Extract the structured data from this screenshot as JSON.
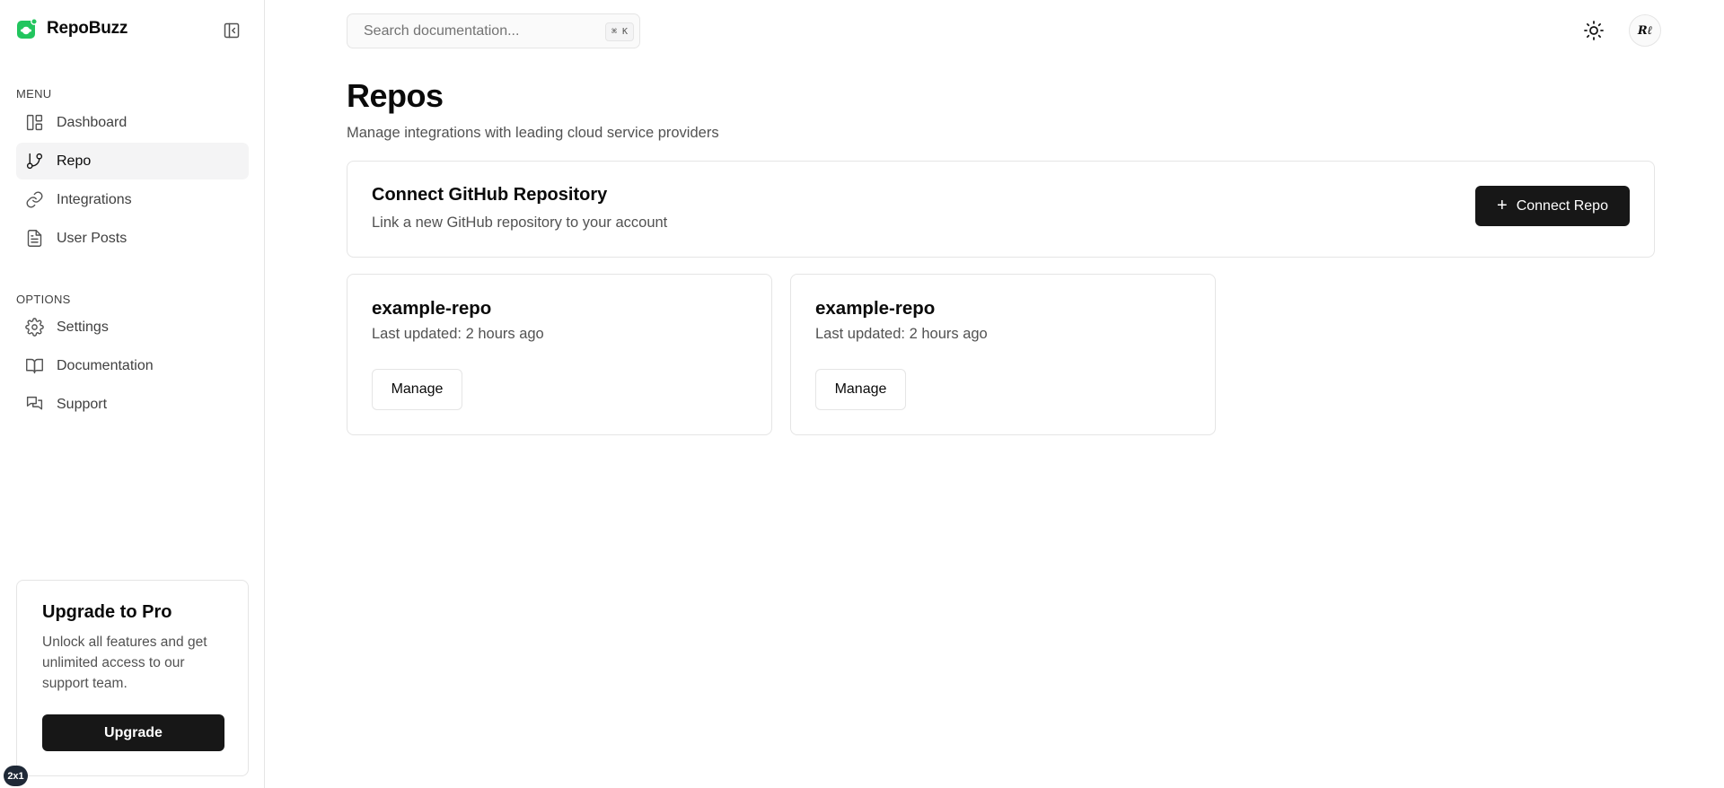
{
  "brand": {
    "name": "RepoBuzz",
    "logo_icon": "repobuzz-logo-icon",
    "accent": "#22c55e"
  },
  "sidebar": {
    "menu_label": "MENU",
    "menu_items": [
      {
        "label": "Dashboard",
        "icon": "dashboard-icon",
        "active": false
      },
      {
        "label": "Repo",
        "icon": "git-branch-icon",
        "active": true
      },
      {
        "label": "Integrations",
        "icon": "link-icon",
        "active": false
      },
      {
        "label": "User Posts",
        "icon": "file-text-icon",
        "active": false
      }
    ],
    "options_label": "OPTIONS",
    "option_items": [
      {
        "label": "Settings",
        "icon": "gear-icon"
      },
      {
        "label": "Documentation",
        "icon": "book-icon"
      },
      {
        "label": "Support",
        "icon": "chat-bubbles-icon"
      }
    ],
    "upgrade": {
      "title": "Upgrade to Pro",
      "text": "Unlock all features and get unlimited access to our support team.",
      "button_label": "Upgrade"
    },
    "corner_badge": "2x1"
  },
  "topbar": {
    "search_placeholder": "Search documentation...",
    "shortcut": "⌘ K",
    "avatar_initials": "Rℓ"
  },
  "main": {
    "title": "Repos",
    "subtitle": "Manage integrations with leading cloud service providers",
    "connect": {
      "title": "Connect GitHub Repository",
      "description": "Link a new GitHub repository to your account",
      "button_label": "Connect Repo"
    },
    "repos": [
      {
        "name": "example-repo",
        "updated": "Last updated: 2 hours ago",
        "button_label": "Manage"
      },
      {
        "name": "example-repo",
        "updated": "Last updated: 2 hours ago",
        "button_label": "Manage"
      }
    ]
  }
}
